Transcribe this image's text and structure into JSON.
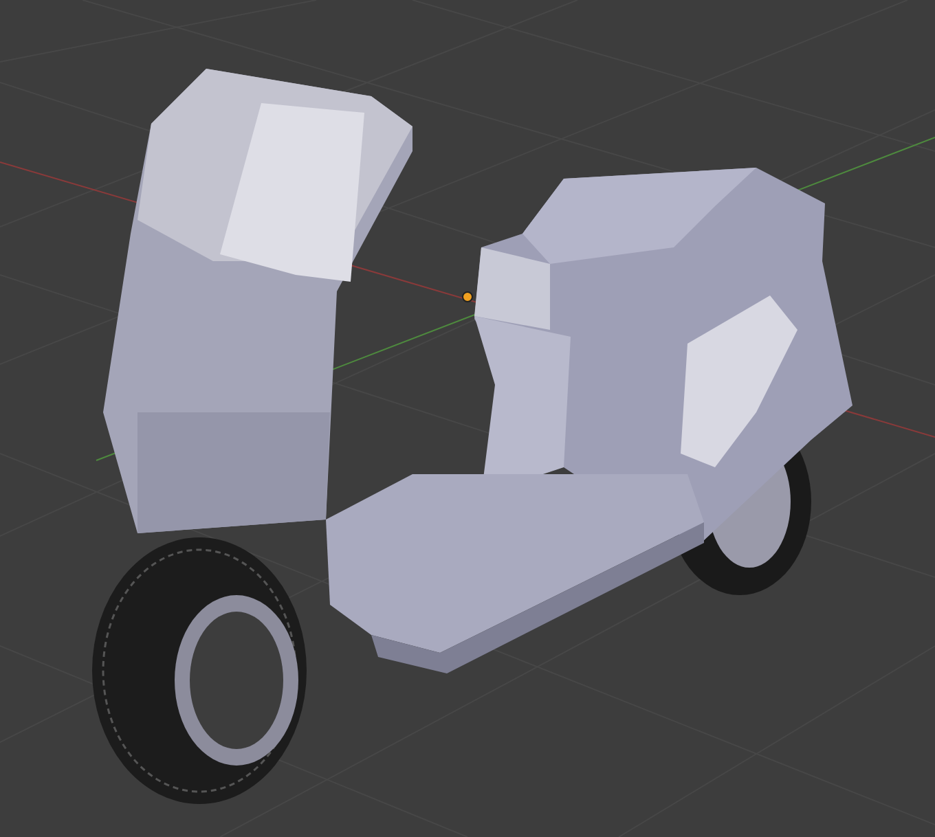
{
  "viewport": {
    "grid": true,
    "axes": true,
    "origin": true
  }
}
